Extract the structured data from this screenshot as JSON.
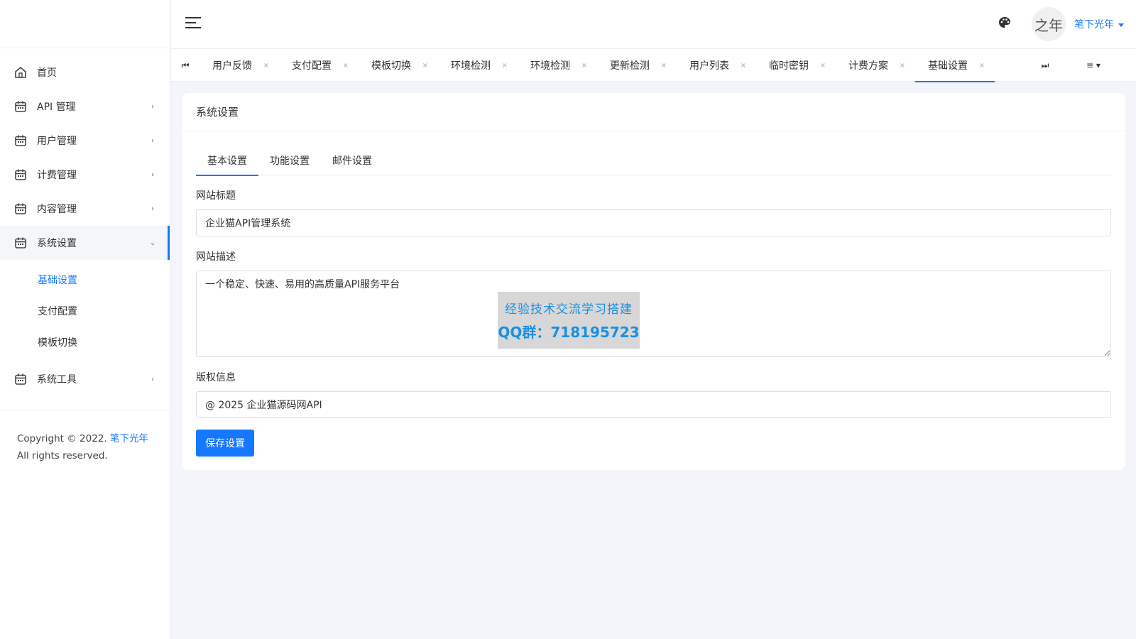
{
  "header": {
    "user_name": "笔下光年",
    "avatar_text": "之年"
  },
  "sidebar": {
    "items": [
      {
        "label": "首页",
        "icon": "home-icon",
        "expandable": false
      },
      {
        "label": "API 管理",
        "icon": "calendar-icon",
        "expandable": true
      },
      {
        "label": "用户管理",
        "icon": "calendar-icon",
        "expandable": true
      },
      {
        "label": "计费管理",
        "icon": "calendar-icon",
        "expandable": true
      },
      {
        "label": "内容管理",
        "icon": "calendar-icon",
        "expandable": true
      },
      {
        "label": "系统设置",
        "icon": "calendar-icon",
        "expandable": true,
        "expanded": true
      },
      {
        "label": "系统工具",
        "icon": "calendar-icon",
        "expandable": true
      }
    ],
    "subitems": [
      "基础设置",
      "支付配置",
      "模板切换"
    ],
    "copyright": {
      "prefix": "Copyright © 2022. ",
      "brand": "笔下光年",
      "suffix": " All rights reserved."
    }
  },
  "tabs": {
    "items": [
      "用户反馈",
      "支付配置",
      "模板切换",
      "环境检测",
      "环境检测",
      "更新检测",
      "用户列表",
      "临时密钥",
      "计费方案",
      "基础设置"
    ],
    "active_index": 9,
    "close_glyph": "×",
    "prev_glyph": "⏮",
    "next_glyph": "⏭",
    "menu_glyph": "≡ ▾"
  },
  "card": {
    "title": "系统设置",
    "subtabs": [
      "基本设置",
      "功能设置",
      "邮件设置"
    ],
    "fields": {
      "site_title_label": "网站标题",
      "site_title_value": "企业猫API管理系统",
      "site_desc_label": "网站描述",
      "site_desc_value": "一个稳定、快速、易用的高质量API服务平台",
      "copyright_label": "版权信息",
      "copyright_value": "@ 2025 企业猫源码网API"
    },
    "save_label": "保存设置"
  },
  "watermark": {
    "line1": "经验技术交流学习搭建",
    "line2": "QQ群：718195723"
  },
  "colors": {
    "accent": "#1677ff",
    "background": "#f4f5fa"
  }
}
